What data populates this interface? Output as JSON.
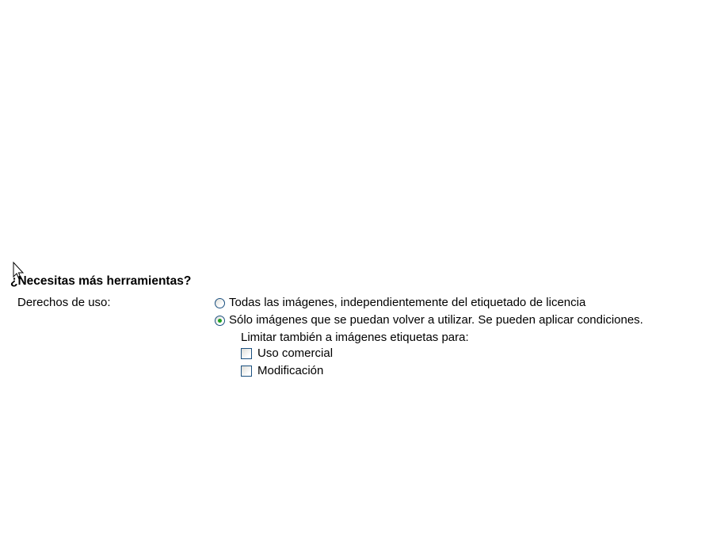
{
  "section": {
    "heading": "¿Necesitas más herramientas?"
  },
  "usage_rights": {
    "label": "Derechos de uso:",
    "options": [
      {
        "label": "Todas las imágenes, independientemente del etiquetado de licencia",
        "selected": false
      },
      {
        "label": "Sólo imágenes que se puedan volver a utilizar. Se pueden aplicar condiciones.",
        "selected": true
      }
    ],
    "limit_label": "Limitar también a imágenes etiquetas para:",
    "checkboxes": [
      {
        "label": "Uso comercial",
        "checked": false
      },
      {
        "label": "Modificación",
        "checked": false
      }
    ]
  },
  "icons": {
    "cursor": "arrow-cursor-icon"
  },
  "colors": {
    "radio_dot": "#21a121",
    "control_border": "#1c5180"
  }
}
